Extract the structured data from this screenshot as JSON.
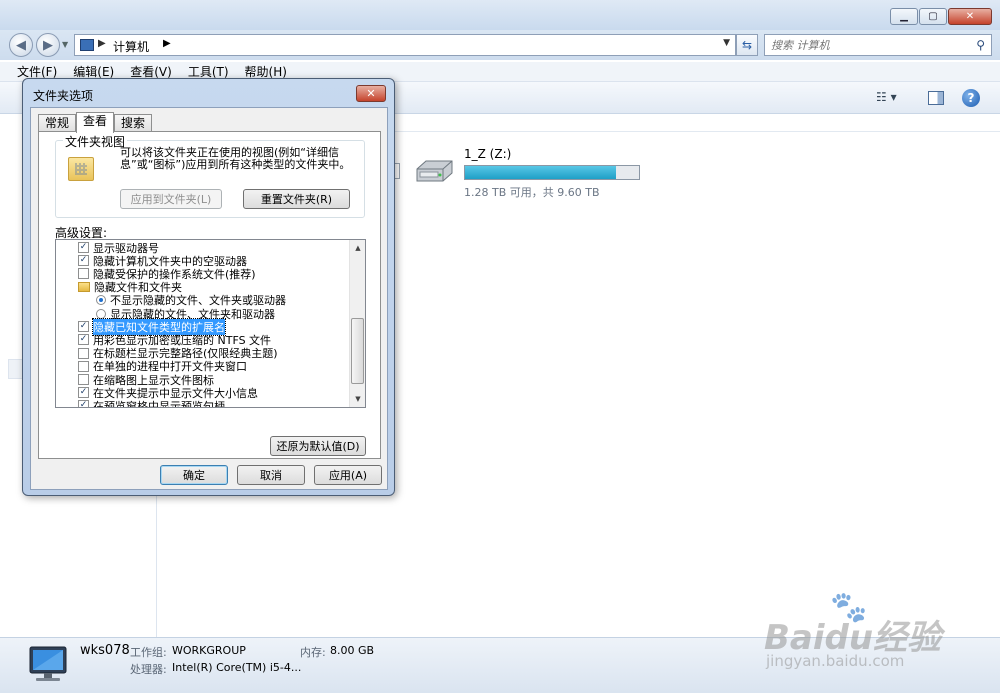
{
  "explorer": {
    "address": {
      "crumb": "计算机"
    },
    "search": {
      "placeholder": "搜索 计算机"
    },
    "menu": [
      "文件(F)",
      "编辑(E)",
      "查看(V)",
      "工具(T)",
      "帮助(H)"
    ],
    "drive": {
      "name": "1_Z (Z:)",
      "info": "1.28 TB 可用，共 9.60 TB",
      "used_fraction": 0.87
    },
    "details": {
      "pc_name": "wks078",
      "workgroup_label": "工作组:",
      "workgroup": "WORKGROUP",
      "memory_label": "内存:",
      "memory": "8.00 GB",
      "cpu_label": "处理器:",
      "cpu": "Intel(R) Core(TM) i5-4..."
    }
  },
  "dialog": {
    "title": "文件夹选项",
    "tabs": [
      "常规",
      "查看",
      "搜索"
    ],
    "active_tab": 1,
    "folder_views": {
      "legend": "文件夹视图",
      "description": "可以将该文件夹正在使用的视图(例如“详细信息”或“图标”)应用到所有这种类型的文件夹中。",
      "apply_button": "应用到文件夹(L)",
      "reset_button": "重置文件夹(R)"
    },
    "advanced_label": "高级设置:",
    "advanced_items": [
      {
        "kind": "checkbox",
        "checked": true,
        "label": "显示驱动器号",
        "indent": 1
      },
      {
        "kind": "checkbox",
        "checked": true,
        "label": "隐藏计算机文件夹中的空驱动器",
        "indent": 1
      },
      {
        "kind": "checkbox",
        "checked": false,
        "label": "隐藏受保护的操作系统文件(推荐)",
        "indent": 1
      },
      {
        "kind": "folder",
        "checked": false,
        "label": "隐藏文件和文件夹",
        "indent": 1
      },
      {
        "kind": "radio",
        "checked": true,
        "label": "不显示隐藏的文件、文件夹或驱动器",
        "indent": 2
      },
      {
        "kind": "radio",
        "checked": false,
        "label": "显示隐藏的文件、文件夹和驱动器",
        "indent": 2
      },
      {
        "kind": "checkbox",
        "checked": true,
        "label": "隐藏已知文件类型的扩展名",
        "indent": 1,
        "selected": true
      },
      {
        "kind": "checkbox",
        "checked": true,
        "label": "用彩色显示加密或压缩的 NTFS 文件",
        "indent": 1
      },
      {
        "kind": "checkbox",
        "checked": false,
        "label": "在标题栏显示完整路径(仅限经典主题)",
        "indent": 1
      },
      {
        "kind": "checkbox",
        "checked": false,
        "label": "在单独的进程中打开文件夹窗口",
        "indent": 1
      },
      {
        "kind": "checkbox",
        "checked": false,
        "label": "在缩略图上显示文件图标",
        "indent": 1
      },
      {
        "kind": "checkbox",
        "checked": true,
        "label": "在文件夹提示中显示文件大小信息",
        "indent": 1
      },
      {
        "kind": "checkbox",
        "checked": true,
        "label": "在预览窗格中显示预览句柄",
        "indent": 1
      }
    ],
    "restore_defaults_button": "还原为默认值(D)",
    "ok_button": "确定",
    "cancel_button": "取消",
    "apply_button": "应用(A)"
  },
  "watermark": {
    "line1": "Baidu经验",
    "line2": "jingyan.baidu.com"
  }
}
